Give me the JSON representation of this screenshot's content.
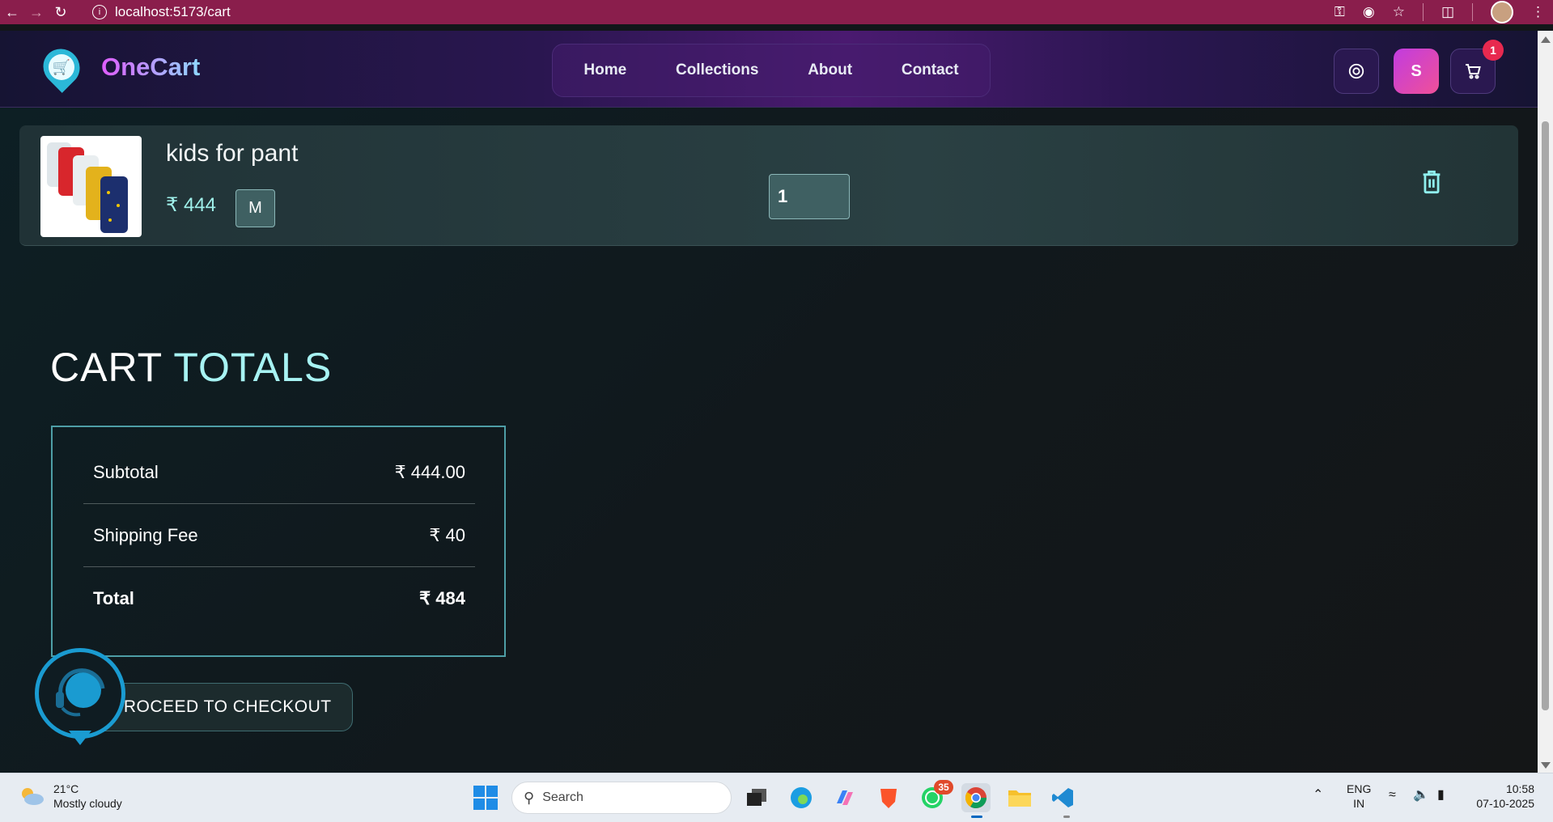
{
  "browser": {
    "url": "localhost:5173/cart"
  },
  "header": {
    "logo_text": "OneCart",
    "nav": [
      "Home",
      "Collections",
      "About",
      "Contact"
    ],
    "profile_initial": "S",
    "cart_count": "1"
  },
  "cart_item": {
    "name": "kids for pant",
    "price": "₹ 444",
    "size": "M",
    "quantity": "1"
  },
  "totals": {
    "title_part1": "CART",
    "title_part2": "TOTALS",
    "subtotal_label": "Subtotal",
    "subtotal_value": "₹ 444.00",
    "shipping_label": "Shipping Fee",
    "shipping_value": "₹ 40",
    "total_label": "Total",
    "total_value": "₹ 484",
    "checkout_label": "PROCEED TO CHECKOUT"
  },
  "taskbar": {
    "weather_temp": "21°C",
    "weather_desc": "Mostly cloudy",
    "search_placeholder": "Search",
    "whatsapp_badge": "35",
    "lang_line1": "ENG",
    "lang_line2": "IN",
    "time": "10:58",
    "date": "07-10-2025"
  },
  "colors": {
    "browser_bar": "#8a1e4c",
    "accent_cyan": "#a7f3f3",
    "badge_red": "#e8294f",
    "profile_gradient_start": "#c13ce0",
    "profile_gradient_end": "#f05098"
  }
}
